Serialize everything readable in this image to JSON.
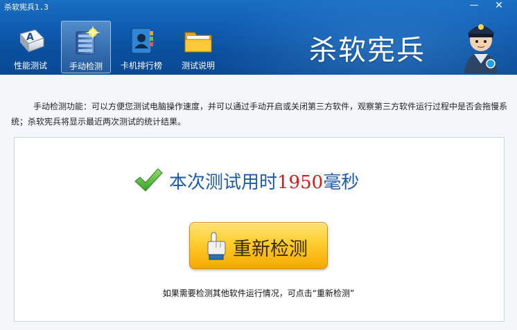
{
  "window": {
    "title": "杀软宪兵1.3",
    "minimize": "—",
    "close": "✕"
  },
  "toolbar": {
    "items": [
      {
        "label": "性能测试",
        "icon": "keyboard-key-icon"
      },
      {
        "label": "手动检测",
        "icon": "server-sparkle-icon",
        "active": true
      },
      {
        "label": "卡机排行榜",
        "icon": "contact-book-icon"
      },
      {
        "label": "测试说明",
        "icon": "folder-icon"
      }
    ]
  },
  "brand": {
    "text": "杀软宪兵",
    "icon": "police-mascot-icon"
  },
  "main": {
    "indent": "",
    "description": "手动检测功能：可以方便您测试电脑操作速度，并可以通过手动开启或关闭第三方软件，观察第三方软件运行过程中是否会拖慢系统；杀软宪兵将显示最近两次测试的统计结果。",
    "result": {
      "prefix": "本次测试用时",
      "value": "1950",
      "unit": "毫秒",
      "icon": "check-icon"
    },
    "retest_button": {
      "label": "重新检测",
      "icon": "pointing-hand-icon"
    },
    "hint": "如果需要检测其他软件运行情况，可点击“重新检测”"
  },
  "colors": {
    "header": "#0f5db3",
    "result_text": "#1f5aa8",
    "result_value": "#d41a1a",
    "button": "#ffcd2e"
  }
}
